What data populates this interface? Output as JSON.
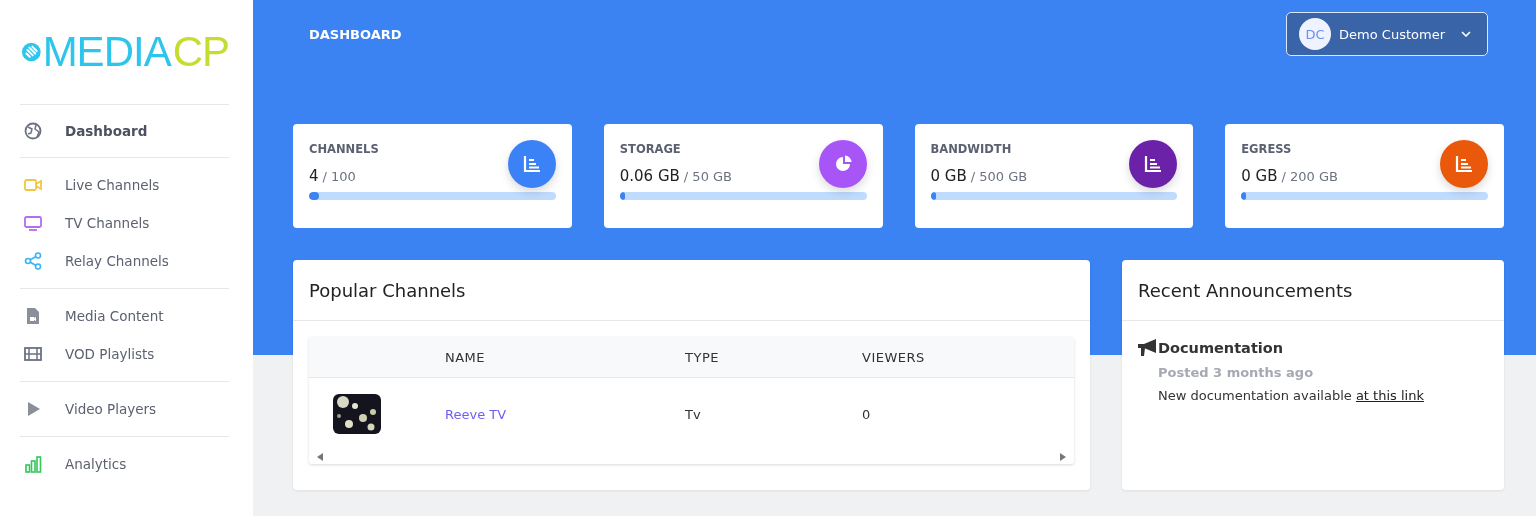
{
  "logo": {
    "part_1": "MEDIA",
    "part_2": "CP"
  },
  "sidebar": {
    "groups": [
      {
        "items": [
          {
            "label": "Dashboard",
            "selected": true
          }
        ]
      },
      {
        "items": [
          {
            "label": "Live Channels",
            "selected": false
          },
          {
            "label": "TV Channels",
            "selected": false
          },
          {
            "label": "Relay Channels",
            "selected": false
          }
        ]
      },
      {
        "items": [
          {
            "label": "Media Content",
            "selected": false
          },
          {
            "label": "VOD Playlists",
            "selected": false
          }
        ]
      },
      {
        "items": [
          {
            "label": "Video Players",
            "selected": false
          }
        ]
      },
      {
        "items": [
          {
            "label": "Analytics",
            "selected": false
          }
        ]
      }
    ]
  },
  "header": {
    "title": "DASHBOARD",
    "user": {
      "initials": "DC",
      "name": "Demo Customer"
    }
  },
  "stats": [
    {
      "label": "CHANNELS",
      "value": "4",
      "total": "/ 100",
      "level": 0.04,
      "color": "#3b82f6"
    },
    {
      "label": "STORAGE",
      "value": "0.06 GB",
      "total": "/ 50 GB",
      "level": 0.0012,
      "color": "#a855f7"
    },
    {
      "label": "BANDWIDTH",
      "value": "0 GB",
      "total": "/ 500 GB",
      "level": 0,
      "color": "#6b21a8"
    },
    {
      "label": "EGRESS",
      "value": "0 GB",
      "total": "/ 200 GB",
      "level": 0,
      "color": "#ea580c"
    }
  ],
  "popular": {
    "title": "Popular Channels",
    "table": {
      "columns": [
        "NAME",
        "TYPE",
        "VIEWERS"
      ],
      "rows": [
        {
          "name": "Reeve TV",
          "type": "Tv",
          "viewers": "0"
        }
      ]
    }
  },
  "announcements": {
    "title": "Recent Announcements",
    "items": [
      {
        "title": "Documentation",
        "posted": "Posted 3 months ago",
        "text": "New documentation available ",
        "link": "at this link"
      }
    ]
  }
}
